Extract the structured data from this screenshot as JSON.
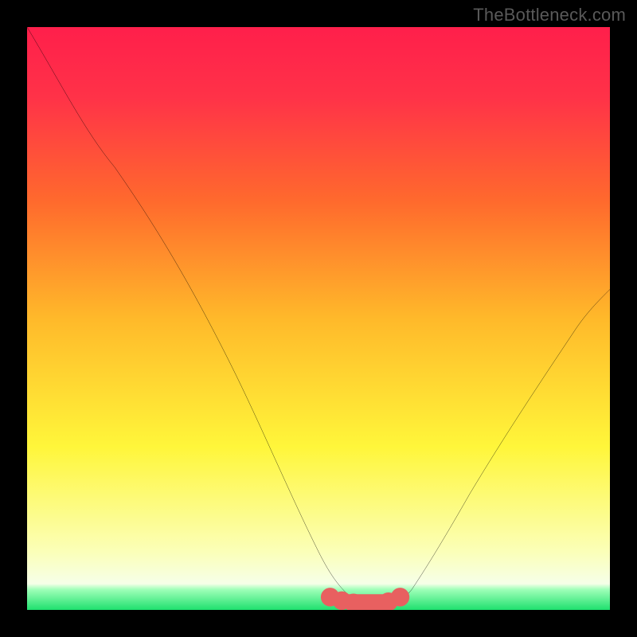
{
  "watermark": "TheBottleneck.com",
  "colors": {
    "top": "#ff1f4b",
    "upper_mid": "#ff6a2d",
    "mid": "#ffb92a",
    "lower_mid": "#fff63a",
    "near_bottom": "#fcffd8",
    "bottom": "#1fe06e",
    "curve": "#000000",
    "valley_marker": "#e86060",
    "valley_dot_outline": "#b94141"
  },
  "chart_data": {
    "type": "line",
    "title": "",
    "xlabel": "",
    "ylabel": "",
    "xlim": [
      0,
      100
    ],
    "ylim": [
      0,
      100
    ],
    "series": [
      {
        "name": "bottleneck-curve",
        "x": [
          0,
          8,
          15,
          22,
          30,
          38,
          45,
          50,
          54,
          57,
          60,
          63,
          66,
          70,
          75,
          82,
          90,
          100
        ],
        "values": [
          100,
          88,
          76,
          64,
          50,
          35,
          20,
          10,
          4,
          1,
          0,
          1,
          4,
          10,
          18,
          29,
          40,
          55
        ]
      }
    ],
    "annotations": [
      {
        "name": "valley-plateau",
        "x_start": 52,
        "x_end": 64,
        "y": 2,
        "style": "thick-red-dotted"
      }
    ]
  }
}
